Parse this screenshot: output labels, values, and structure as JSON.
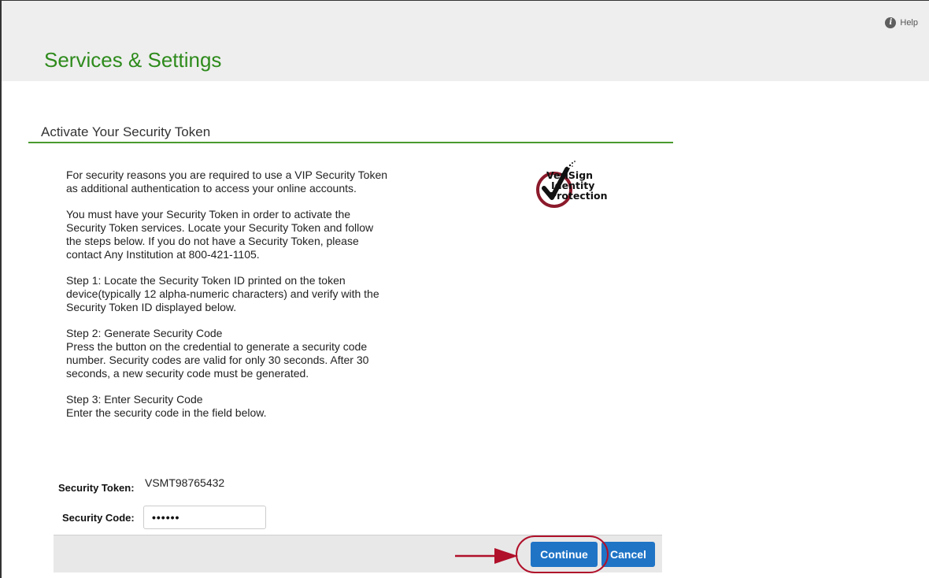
{
  "header": {
    "help_label": "Help",
    "help_icon": "info-icon",
    "title": "Services & Settings"
  },
  "section": {
    "title": "Activate Your Security Token"
  },
  "instructions": {
    "p1": "For security reasons you are required to use a VIP Security Token\nas additional authentication to access your online accounts.",
    "p2": "You must have your Security Token in order to activate the\nSecurity Token services. Locate your Security Token and follow\nthe steps below. If you do not have a Security Token, please\ncontact Any Institution at 800-421-1105.",
    "p3": "Step 1: Locate the Security Token ID printed on the token\ndevice(typically 12 alpha-numeric characters) and verify with the\nSecurity Token ID displayed below.",
    "p4": "Step 2: Generate Security Code\nPress the button on the credential to generate a security code\nnumber. Security codes are valid for only 30 seconds. After 30\nseconds, a new security code must be generated.",
    "p5": "Step 3: Enter Security Code\nEnter the security code in the field below."
  },
  "logo": {
    "line1": "VeriSign",
    "line2": "Identity",
    "line3": "Protection",
    "accent": "#8b1a2b"
  },
  "form": {
    "token_label": "Security Token:",
    "token_value": "VSMT98765432",
    "code_label": "Security Code:",
    "code_value": "••••••"
  },
  "buttons": {
    "continue_label": "Continue",
    "cancel_label": "Cancel"
  },
  "colors": {
    "brand_green": "#2e8b1c",
    "button_blue": "#1f74c6",
    "annotation_red": "#b0102a"
  }
}
